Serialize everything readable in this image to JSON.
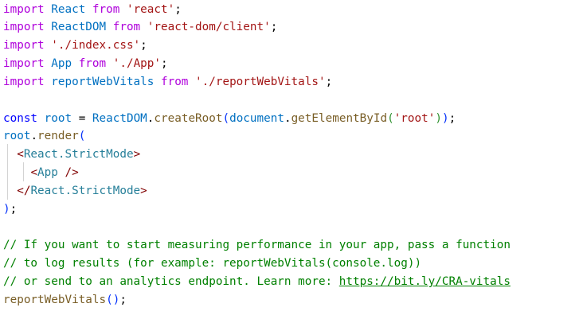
{
  "editor": {
    "lines": {
      "l1": {
        "kw1": "import",
        "id": " React ",
        "kw2": "from",
        "sp": " ",
        "str": "'react'",
        "end": ";"
      },
      "l2": {
        "kw1": "import",
        "id": " ReactDOM ",
        "kw2": "from",
        "sp": " ",
        "str": "'react-dom/client'",
        "end": ";"
      },
      "l3": {
        "kw1": "import",
        "sp": " ",
        "str": "'./index.css'",
        "end": ";"
      },
      "l4": {
        "kw1": "import",
        "id": " App ",
        "kw2": "from",
        "sp": " ",
        "str": "'./App'",
        "end": ";"
      },
      "l5": {
        "kw1": "import",
        "id": " reportWebVitals ",
        "kw2": "from",
        "sp": " ",
        "str": "'./reportWebVitals'",
        "end": ";"
      },
      "l7": {
        "kw": "const",
        "sp1": " ",
        "var": "root",
        "eq": " = ",
        "obj": "ReactDOM",
        "dot1": ".",
        "fn1": "createRoot",
        "p1": "(",
        "doc": "document",
        "dot2": ".",
        "fn2": "getElementById",
        "p2": "(",
        "str": "'root'",
        "p3": ")",
        "p4": ")",
        "end": ";"
      },
      "l8": {
        "var": "root",
        "dot": ".",
        "fn": "render",
        "p": "("
      },
      "l9": {
        "indent": "  ",
        "open": "<",
        "name": "React.StrictMode",
        "close": ">"
      },
      "l10": {
        "indent": "    ",
        "open": "<",
        "name": "App",
        "close": " />"
      },
      "l11": {
        "indent": "  ",
        "open": "</",
        "name": "React.StrictMode",
        "close": ">"
      },
      "l12": {
        "p": ")",
        "end": ";"
      },
      "l14": {
        "comment": "// If you want to start measuring performance in your app, pass a function"
      },
      "l15": {
        "comment": "// to log results (for example: reportWebVitals(console.log))"
      },
      "l16": {
        "comment": "// or send to an analytics endpoint. Learn more: ",
        "link": "https://bit.ly/CRA-vitals"
      },
      "l17": {
        "fn": "reportWebVitals",
        "p": "()",
        "end": ";"
      }
    }
  }
}
